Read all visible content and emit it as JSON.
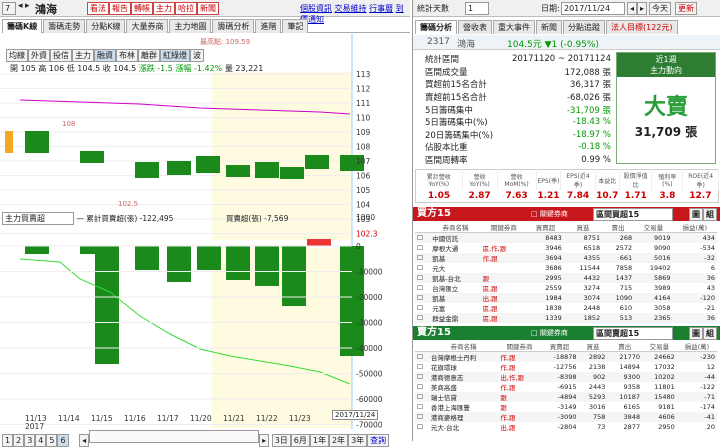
{
  "top": {
    "code": "7",
    "name": "鴻海",
    "buttons": [
      "看法",
      "報告",
      "轉帳",
      "主力",
      "哈拉",
      "新聞"
    ],
    "links": [
      "個股資訊",
      "交易維持",
      "行事曆",
      "到價通知"
    ],
    "date_label": "日期:",
    "date": "2017/11/24",
    "today": "今天",
    "refresh": "更新",
    "stat_label": "統計天數",
    "stat_value": "1"
  },
  "left_tabs": [
    "籌碼K線",
    "籌碼走勢",
    "分點K線",
    "大量券商",
    "主力地圖",
    "籌碼分析",
    "進階",
    "筆記"
  ],
  "period_tabs": [
    "均線",
    "外資",
    "投信",
    "主力",
    "融資",
    "布林",
    "離群",
    "紅綠燈",
    "波"
  ],
  "ohlc": {
    "open": "開 105",
    "high": "高 106",
    "low": "低 104.5",
    "close": "收 104.5",
    "chg": "漲跌 -1.5",
    "pct": "漲幅 -1.42%",
    "vol": "量 23,221"
  },
  "ma_note": "最高點: 109.59",
  "price_axis": [
    "113",
    "112",
    "111",
    "110",
    "109",
    "108",
    "107",
    "106",
    "105",
    "104",
    "103",
    "102.3"
  ],
  "price_marks": {
    "hi": "108",
    "lo": "102.5"
  },
  "sub": {
    "select": "主力買賣超",
    "legend1": "— 累計買賣超(張) -122,495",
    "legend2": "買賣超(張) -7,569"
  },
  "vol_axis": [
    "0",
    "-10000",
    "-20000",
    "-30000",
    "-40000",
    "-50000",
    "-60000",
    "-70000"
  ],
  "vol_top": "1000",
  "xdates": [
    "11/13",
    "11/14",
    "11/15",
    "11/16",
    "11/17",
    "11/20",
    "11/21",
    "11/22",
    "11/23"
  ],
  "xyear": "2017",
  "xcursor": "2017/11/24",
  "bottom": {
    "pages": [
      "1",
      "2",
      "3",
      "4",
      "5",
      "6"
    ],
    "ranges": [
      "3日",
      "6月",
      "1年",
      "2年",
      "3年",
      "查詢"
    ]
  },
  "right_tabs": [
    "籌碼分析",
    "營收表",
    "重大事件",
    "新聞",
    "分點追蹤",
    "法人目標(122元)"
  ],
  "stock": {
    "id": "2317",
    "name": "鴻海",
    "price": "104.5元 ▼1 (-0.95%)"
  },
  "stats": [
    [
      "統計區間",
      "20171120 ~ 20171124"
    ],
    [
      "區間成交量",
      "172,088 張"
    ],
    [
      "買超前15名合計",
      "36,317 張"
    ],
    [
      "賣超前15名合計",
      "-68,026 張"
    ],
    [
      "5日籌碼集中",
      "-31,709 張"
    ],
    [
      "5日籌碼集中(%)",
      "-18.43 %"
    ],
    [
      "20日籌碼集中(%)",
      "-18.97 %"
    ],
    [
      "佔股本比重",
      "-0.18 %"
    ],
    [
      "區間周轉率",
      "0.99 %"
    ]
  ],
  "summary": {
    "period": "近1週",
    "mode": "主力動向",
    "verdict": "大賣",
    "amount": "31,709 張"
  },
  "metrics": {
    "heads": [
      "累計營收YoY(%)",
      "營收YoY(%)",
      "營收MoM(%)",
      "EPS(季)",
      "EPS(近4季)",
      "本益比",
      "股價淨值比",
      "殖利率(%)",
      "ROE(近4季)"
    ],
    "values": [
      "1.05",
      "2.87",
      "7.63",
      "1.21",
      "7.84",
      "10.7",
      "1.71",
      "3.8",
      "12.7"
    ]
  },
  "buy": {
    "title": "買方15",
    "filter": "□ 關鍵券商",
    "select": "區間買超15",
    "btn1": "圖",
    "btn2": "組",
    "cols": [
      "券商名稱",
      "關鍵券商",
      "買賣超",
      "買進",
      "賣出",
      "交易量",
      "損益(萬)"
    ],
    "rows": [
      [
        "中國信託",
        "",
        "8483",
        "8751",
        "268",
        "9019",
        "434"
      ],
      [
        "摩根大通",
        "區,作,跟",
        "3946",
        "6518",
        "2572",
        "9090",
        "-534"
      ],
      [
        "凱基",
        "作,跟",
        "3694",
        "4355",
        "661",
        "5016",
        "-32"
      ],
      [
        "元大",
        "",
        "3686",
        "11544",
        "7858",
        "19402",
        "6"
      ],
      [
        "凱基-台北",
        "跟",
        "2995",
        "4432",
        "1437",
        "5869",
        "36"
      ],
      [
        "台灣匯立",
        "區,跟",
        "2559",
        "3274",
        "715",
        "3989",
        "43"
      ],
      [
        "凱基",
        "出,跟",
        "1984",
        "3074",
        "1090",
        "4164",
        "-120"
      ],
      [
        "元富",
        "區,跟",
        "1838",
        "2448",
        "610",
        "3058",
        "-21"
      ],
      [
        "群益金鼎",
        "區,跟",
        "1339",
        "1852",
        "513",
        "2365",
        "36"
      ]
    ]
  },
  "sell": {
    "title": "賣方15",
    "filter": "□ 關鍵券商",
    "select": "區間賣超15",
    "btn1": "圖",
    "btn2": "組",
    "cols": [
      "券商名稱",
      "關鍵券商",
      "買賣超",
      "買進",
      "賣出",
      "交易量",
      "損益(萬)"
    ],
    "rows": [
      [
        "台灣摩根士丹利",
        "作,跟",
        "-18878",
        "2892",
        "21770",
        "24662",
        "-230"
      ],
      [
        "花旗環球",
        "作,跟",
        "-12756",
        "2138",
        "14894",
        "17032",
        "12"
      ],
      [
        "港商德意志",
        "出,作,跟",
        "-8398",
        "902",
        "9300",
        "10202",
        "-44"
      ],
      [
        "美商高盛",
        "作,跟",
        "-6915",
        "2443",
        "9358",
        "11801",
        "-122"
      ],
      [
        "瑞士信貸",
        "跟",
        "-4894",
        "5293",
        "10187",
        "15480",
        "-71"
      ],
      [
        "香港上海匯豐",
        "跟",
        "-3149",
        "3016",
        "6165",
        "9181",
        "-174"
      ],
      [
        "港商麥格理",
        "作,跟",
        "-3090",
        "758",
        "3848",
        "4606",
        "-41"
      ],
      [
        "元大-台北",
        "出,跟",
        "-2804",
        "73",
        "2877",
        "2950",
        "20"
      ]
    ]
  }
}
